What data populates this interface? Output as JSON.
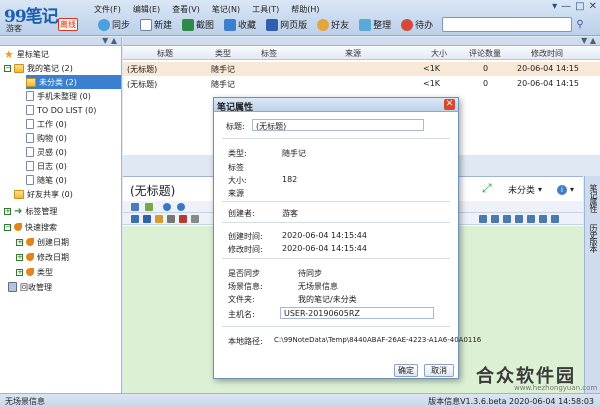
{
  "app": {
    "logo_text": "99笔记",
    "user": "游客",
    "status": "离线"
  },
  "menu": [
    "文件(F)",
    "编辑(E)",
    "查看(V)",
    "笔记(N)",
    "工具(T)",
    "帮助(H)"
  ],
  "toolbar": {
    "sync": "同步",
    "new": "新建",
    "screenshot": "截图",
    "collect": "收藏",
    "web_clip": "网页版",
    "friends": "好友",
    "organize": "整理",
    "todo": "待办"
  },
  "sidebar": {
    "items": [
      {
        "label": "星标笔记",
        "level": 0
      },
      {
        "label": "我的笔记 (2)",
        "level": 0
      },
      {
        "label": "未分类 (2)",
        "level": 1,
        "selected": true
      },
      {
        "label": "手机未整理 (0)",
        "level": 1
      },
      {
        "label": "TO DO LIST (0)",
        "level": 1
      },
      {
        "label": "工作 (0)",
        "level": 1
      },
      {
        "label": "购物 (0)",
        "level": 1
      },
      {
        "label": "灵感 (0)",
        "level": 1
      },
      {
        "label": "日志 (0)",
        "level": 1
      },
      {
        "label": "随笔 (0)",
        "level": 1
      },
      {
        "label": "好友共享 (0)",
        "level": 0
      },
      {
        "label": "标签管理",
        "level": 0
      },
      {
        "label": "快速搜索",
        "level": 0
      },
      {
        "label": "创建日期",
        "level": 1
      },
      {
        "label": "修改日期",
        "level": 1
      },
      {
        "label": "类型",
        "level": 1
      },
      {
        "label": "回收管理",
        "level": 0
      }
    ]
  },
  "list": {
    "columns": [
      "标题",
      "类型",
      "标签",
      "来源",
      "大小",
      "评论数量",
      "修改时间"
    ],
    "rows": [
      [
        "(无标题)",
        "随手记",
        "",
        "",
        "<1K",
        "0",
        "20-06-04 14:15"
      ],
      [
        "(无标题)",
        "随手记",
        "",
        "",
        "<1K",
        "0",
        "20-06-04 14:15"
      ]
    ]
  },
  "editor": {
    "title": "(无标题)",
    "category": "未分类"
  },
  "vtabs": [
    "笔记属性",
    "历史版本"
  ],
  "dialog": {
    "title": "笔记属性",
    "title_label": "标题:",
    "title_value": "(无标题)",
    "type_label": "类型:",
    "type_value": "随手记",
    "tag_label": "标签",
    "size_label": "大小:",
    "size_value": "182",
    "source_label": "来源",
    "creator_label": "创建者:",
    "creator_value": "游客",
    "created_label": "创建时间:",
    "created_value": "2020-06-04 14:15:44",
    "modified_label": "修改时间:",
    "modified_value": "2020-06-04 14:15:44",
    "sync_label": "是否同步",
    "sync_value": "待同步",
    "scene_label": "场景信息:",
    "scene_value": "无场景信息",
    "folder_label": "文件夹:",
    "folder_value": "我的笔记/未分类",
    "host_label": "主机名:",
    "host_value": "USER-20190605RZ",
    "path_label": "本地路径:",
    "path_value": "C:\\99NoteData\\Temp\\8440ABAF-26AE-4223-A1A6-40A0116",
    "ok_label": "确定",
    "cancel_label": "取消"
  },
  "statusbar": {
    "left": "无场景信息",
    "right": "版本信息V1.3.6.beta 2020-06-04 14:58:03"
  },
  "watermark": {
    "text": "合众软件园",
    "url": "www.hezhongyuan.com"
  },
  "colors": {
    "selection_blue": "#3b7fd1",
    "row_highlight": "#f8e8d6",
    "editor_body": "#dcf0d4"
  }
}
